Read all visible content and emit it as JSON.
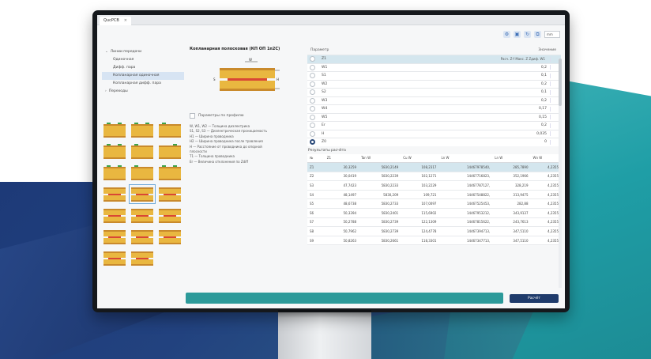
{
  "window": {
    "tab_title": "QucPCB",
    "tab_close": "×"
  },
  "toolbar": {
    "icons": [
      "gear-icon",
      "save-icon",
      "refresh-icon",
      "copy-icon"
    ],
    "icon_glyphs": [
      "⚙",
      "▣",
      "↻",
      "⧉"
    ],
    "select_value": "mm"
  },
  "tree": {
    "items": [
      {
        "label": "Линии передачи",
        "arrow": "⌄",
        "level": "top"
      },
      {
        "label": "Одиночная",
        "level": "child"
      },
      {
        "label": "Дифф. пара",
        "level": "child"
      },
      {
        "label": "Копланарная одиночная",
        "level": "child",
        "selected": true
      },
      {
        "label": "Копланарная дифф. пара",
        "level": "child"
      },
      {
        "label": "Переходы",
        "arrow": "›",
        "level": "top"
      }
    ]
  },
  "middle": {
    "title": "Копланарная полосковая (КП ОП 1п2С)",
    "checkbox_label": "Параметры по профилю",
    "legend": [
      "W, W1, W2 — Толщина диэлектрика",
      "S1, S2, S3 — Диэлектрическая проницаемость",
      "H1 — Ширина проводника",
      "H2 — Ширина проводника после травления",
      "H — Расстояние от проводника до опорной",
      "        плоскости",
      "T1 — Толщина проводника",
      "Er — Величина отклонения по Zdiff"
    ],
    "diagram_labels": [
      "W",
      "S",
      "H"
    ]
  },
  "params": {
    "header_left": "Параметр",
    "header_right": "Значение",
    "selected_extra": "Расч. Z-f  Макс. Z  Zдиф. W1",
    "rows": [
      {
        "label": "Z1",
        "value": "",
        "selected": true
      },
      {
        "label": "W1",
        "value": "0,2"
      },
      {
        "label": "S1",
        "value": "0,1"
      },
      {
        "label": "W2",
        "value": "0,2"
      },
      {
        "label": "S2",
        "value": "0,1"
      },
      {
        "label": "W3",
        "value": "0,2"
      },
      {
        "label": "W4",
        "value": "0,17"
      },
      {
        "label": "W5",
        "value": "0,15"
      },
      {
        "label": "Er",
        "value": "0,2"
      },
      {
        "label": "H",
        "value": "0,035"
      },
      {
        "label": "Z0",
        "value": "0",
        "radio_on": true
      }
    ]
  },
  "results": {
    "title": "Результаты расчёта",
    "columns": [
      "№",
      "Z1",
      "Tan W",
      "Cu W",
      "Ln W",
      "Ln W",
      "Wn W"
    ],
    "rows": [
      [
        "Z1",
        "30,3259",
        "5830,2149",
        "108,2317",
        "14467978540,",
        "285,7890",
        "4,2355"
      ],
      [
        "Z2",
        "30,0419",
        "5830,2239",
        "102,1271",
        "14467716823,",
        "352,1966",
        "4,2355"
      ],
      [
        "S3",
        "47,7423",
        "5830,2233",
        "103,2229",
        "14467787127,",
        "328,219",
        "4,2355"
      ],
      [
        "S4",
        "48,1497",
        "5830,209",
        "109,721",
        "14467548822,",
        "313,9475",
        "4,2355"
      ],
      [
        "S5",
        "48,6738",
        "5830,2733",
        "107,0097",
        "14467525453,",
        "282,88",
        "4,2355"
      ],
      [
        "S6",
        "50,3394",
        "5830,2401",
        "115,6902",
        "14467953212,",
        "343,9137",
        "4,2355"
      ],
      [
        "S7",
        "50,2788",
        "5830,2739",
        "122,1309",
        "14467815622,",
        "243,7613",
        "4,2355"
      ],
      [
        "S8",
        "50,7962",
        "5830,2739",
        "124,4778",
        "14467394713,",
        "347,5110",
        "4,2355"
      ],
      [
        "S9",
        "50,8263",
        "5830,2661",
        "118,3301",
        "14467347713,",
        "347,5110",
        "4,2355"
      ]
    ]
  },
  "progress": {
    "value": 1.0
  },
  "calc_button": "Расчёт",
  "colors": {
    "accent": "#2c9a9a",
    "button": "#1f3b6b",
    "selection": "#d4e6ee",
    "copper": "#c98a2c",
    "core": "#e9b740"
  }
}
